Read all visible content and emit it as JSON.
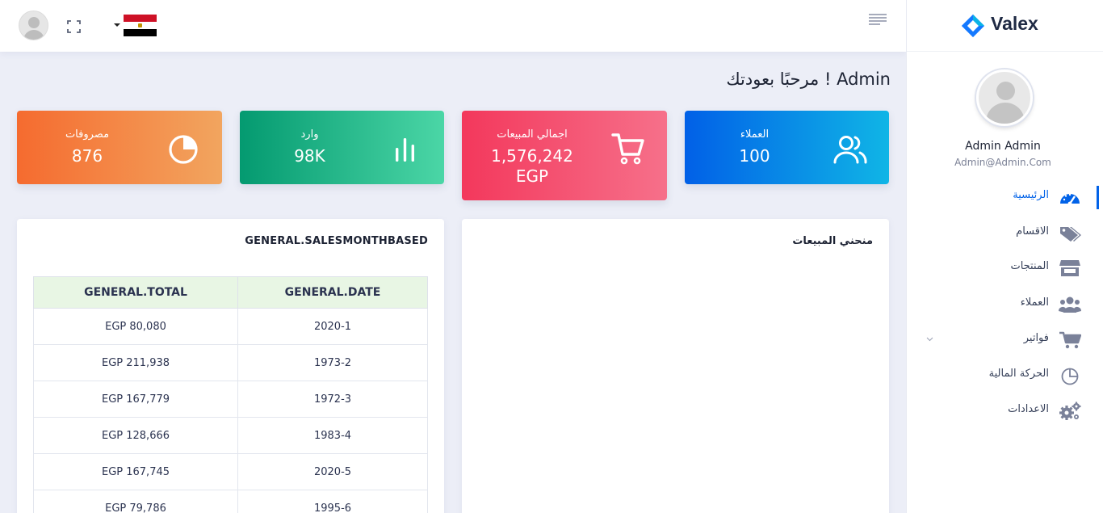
{
  "brand": {
    "name": "Valex",
    "logo_icon": "valex-logo-icon",
    "logo_colors": [
      "#1479ff",
      "#0ab4e6"
    ]
  },
  "header": {
    "language_flag": "egypt-flag-icon",
    "fullscreen_icon": "fullscreen-icon",
    "menu_icon": "menu-toggle-icon"
  },
  "profile": {
    "name": "Admin Admin",
    "email": "Admin@Admin.Com"
  },
  "sidebar": {
    "items": [
      {
        "label": "الرئيسية",
        "icon": "dashboard-gauge-icon",
        "active": true
      },
      {
        "label": "الاقسام",
        "icon": "tags-icon"
      },
      {
        "label": "المنتجات",
        "icon": "store-icon"
      },
      {
        "label": "العملاء",
        "icon": "users-icon"
      },
      {
        "label": "فواتير",
        "icon": "cart-icon",
        "has_submenu": true
      },
      {
        "label": "الحركة المالية",
        "icon": "pie-chart-icon"
      },
      {
        "label": "الاعدادات",
        "icon": "gears-icon"
      }
    ]
  },
  "main": {
    "welcome": "مرحبًا بعودتك ! Admin",
    "cards": [
      {
        "label": "مصروفات",
        "value": "876",
        "icon": "pie-chart-icon",
        "color": "#f56b2f"
      },
      {
        "label": "وارد",
        "value": "98K",
        "icon": "bar-chart-icon",
        "color": "#049a70"
      },
      {
        "label": "اجمالي المبيعات",
        "value": "1,576,242",
        "unit": "EGP",
        "icon": "cart-icon",
        "color": "#f3385c"
      },
      {
        "label": "العملاء",
        "value": "100",
        "icon": "users-icon",
        "color": "#0160e7"
      }
    ],
    "sales_table": {
      "title": "GENERAL.SALESMONTHBASED",
      "columns": [
        "GENERAL.TOTAL",
        "GENERAL.DATE"
      ],
      "rows": [
        [
          "EGP 80,080",
          "2020-1"
        ],
        [
          "EGP 211,938",
          "1973-2"
        ],
        [
          "EGP 167,779",
          "1972-3"
        ],
        [
          "EGP 128,666",
          "1983-4"
        ],
        [
          "EGP 167,745",
          "2020-5"
        ],
        [
          "EGP 79,786",
          "1995-6"
        ]
      ]
    },
    "sales_chart": {
      "title": "منحني المبيعات"
    }
  }
}
